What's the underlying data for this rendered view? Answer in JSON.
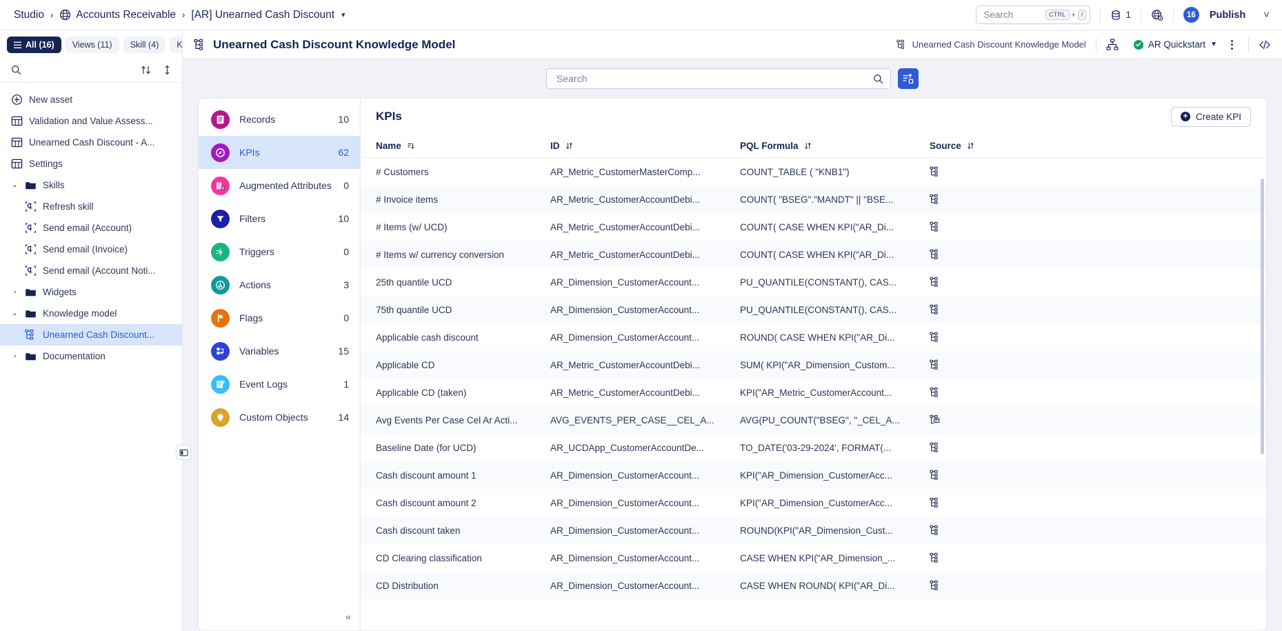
{
  "topbar": {
    "breadcrumbs": [
      {
        "label": "Studio",
        "icon": null
      },
      {
        "label": "Accounts Receivable",
        "icon": "globe-icon"
      },
      {
        "label": "[AR] Unearned Cash Discount",
        "icon": null,
        "caret": true
      }
    ],
    "search": {
      "placeholder": "Search",
      "kbd_ctrl": "CTRL",
      "kbd_plus": "+",
      "kbd_slash": "/"
    },
    "data_pool_count": "1",
    "publish": {
      "badge": "16",
      "label": "Publish"
    }
  },
  "sidebar": {
    "filter_tabs": [
      {
        "label": "All (16)",
        "active": true,
        "icon": "list-icon"
      },
      {
        "label": "Views (11)",
        "active": false
      },
      {
        "label": "Skill (4)",
        "active": false
      },
      {
        "label": "Know",
        "active": false
      },
      {
        "label": "•••",
        "active": false
      }
    ],
    "search_placeholder": "",
    "tree": [
      {
        "label": "New asset",
        "icon": "plus-circle-icon",
        "level": 0,
        "type": "action"
      },
      {
        "label": "Validation and Value Assess...",
        "icon": "view-icon",
        "level": 0,
        "type": "view"
      },
      {
        "label": "Unearned Cash Discount - A...",
        "icon": "view-icon",
        "level": 0,
        "type": "view"
      },
      {
        "label": "Settings",
        "icon": "view-icon",
        "level": 0,
        "type": "view"
      },
      {
        "label": "Skills",
        "icon": "folder-icon",
        "level": 0,
        "type": "folder",
        "expanded": true
      },
      {
        "label": "Refresh skill",
        "icon": "skill-icon",
        "level": 1,
        "type": "skill"
      },
      {
        "label": "Send email (Account)",
        "icon": "skill-icon",
        "level": 1,
        "type": "skill"
      },
      {
        "label": "Send email (Invoice)",
        "icon": "skill-icon",
        "level": 1,
        "type": "skill"
      },
      {
        "label": "Send email (Account Noti...",
        "icon": "skill-icon",
        "level": 1,
        "type": "skill"
      },
      {
        "label": "Widgets",
        "icon": "folder-icon",
        "level": 0,
        "type": "folder",
        "expanded": false
      },
      {
        "label": "Knowledge model",
        "icon": "folder-icon",
        "level": 0,
        "type": "folder",
        "expanded": true
      },
      {
        "label": "Unearned Cash Discount...",
        "icon": "knowledge-model-icon",
        "level": 1,
        "type": "km",
        "selected": true
      },
      {
        "label": "Documentation",
        "icon": "folder-icon",
        "level": 0,
        "type": "folder",
        "expanded": false
      }
    ]
  },
  "main": {
    "title": "Unearned Cash Discount Knowledge Model",
    "header_crumb": "Unearned Cash Discount Knowledge Model",
    "environment": "AR Quickstart",
    "search_placeholder": "Search"
  },
  "categories": [
    {
      "label": "Records",
      "count": "10",
      "color": "#b5168e",
      "icon": "records-icon",
      "active": false
    },
    {
      "label": "KPIs",
      "count": "62",
      "color": "#a21ac0",
      "icon": "kpi-icon",
      "active": true
    },
    {
      "label": "Augmented Attributes",
      "count": "0",
      "color": "#f5359e",
      "icon": "augmented-icon",
      "active": false
    },
    {
      "label": "Filters",
      "count": "10",
      "color": "#1a1ea8",
      "icon": "filter-icon",
      "active": false
    },
    {
      "label": "Triggers",
      "count": "0",
      "color": "#17b583",
      "icon": "trigger-icon",
      "active": false
    },
    {
      "label": "Actions",
      "count": "3",
      "color": "#0d9a9a",
      "icon": "action-icon",
      "active": false
    },
    {
      "label": "Flags",
      "count": "0",
      "color": "#e8730c",
      "icon": "flag-icon",
      "active": false
    },
    {
      "label": "Variables",
      "count": "15",
      "color": "#2f44d4",
      "icon": "variable-icon",
      "active": false
    },
    {
      "label": "Event Logs",
      "count": "1",
      "color": "#38bdf8",
      "icon": "eventlog-icon",
      "active": false
    },
    {
      "label": "Custom Objects",
      "count": "14",
      "color": "#d9a429",
      "icon": "custom-obj-icon",
      "active": false
    }
  ],
  "table": {
    "title": "KPIs",
    "create_label": "Create KPI",
    "columns": [
      {
        "label": "Name",
        "sort": "asc"
      },
      {
        "label": "ID",
        "sort": "none"
      },
      {
        "label": "PQL Formula",
        "sort": "none"
      },
      {
        "label": "Source",
        "sort": "none"
      }
    ],
    "rows": [
      {
        "name": "# Customers",
        "id": "AR_Metric_CustomerMasterComp...",
        "pql": "COUNT_TABLE ( \"KNB1\")",
        "source": "knowledge-model-icon"
      },
      {
        "name": "# Invoice items",
        "id": "AR_Metric_CustomerAccountDebi...",
        "pql": "COUNT( \"BSEG\".\"MANDT\" || \"BSE...",
        "source": "knowledge-model-icon"
      },
      {
        "name": "# Items (w/ UCD)",
        "id": "AR_Metric_CustomerAccountDebi...",
        "pql": "COUNT( CASE WHEN KPI(\"AR_Di...",
        "source": "knowledge-model-icon"
      },
      {
        "name": "# Items w/ currency conversion",
        "id": "AR_Metric_CustomerAccountDebi...",
        "pql": "COUNT( CASE WHEN KPI(\"AR_Di...",
        "source": "knowledge-model-icon"
      },
      {
        "name": "25th quantile UCD",
        "id": "AR_Dimension_CustomerAccount...",
        "pql": "PU_QUANTILE(CONSTANT(), CAS...",
        "source": "knowledge-model-icon"
      },
      {
        "name": "75th quantile UCD",
        "id": "AR_Dimension_CustomerAccount...",
        "pql": "PU_QUANTILE(CONSTANT(), CAS...",
        "source": "knowledge-model-icon"
      },
      {
        "name": "Applicable cash discount",
        "id": "AR_Dimension_CustomerAccount...",
        "pql": "ROUND( CASE WHEN KPI(\"AR_Di...",
        "source": "knowledge-model-icon"
      },
      {
        "name": "Applicable CD",
        "id": "AR_Metric_CustomerAccountDebi...",
        "pql": "SUM( KPI(\"AR_Dimension_Custom...",
        "source": "knowledge-model-icon"
      },
      {
        "name": "Applicable CD (taken)",
        "id": "AR_Metric_CustomerAccountDebi...",
        "pql": "KPI(\"AR_Metric_CustomerAccount...",
        "source": "knowledge-model-icon"
      },
      {
        "name": "Avg Events Per Case Cel Ar Acti...",
        "id": "AVG_EVENTS_PER_CASE__CEL_A...",
        "pql": "AVG(PU_COUNT(\"BSEG\", \"_CEL_A...",
        "source": "event-log-source-icon"
      },
      {
        "name": "Baseline Date (for UCD)",
        "id": "AR_UCDApp_CustomerAccountDe...",
        "pql": "TO_DATE('03-29-2024', FORMAT(...",
        "source": "knowledge-model-icon"
      },
      {
        "name": "Cash discount amount 1",
        "id": "AR_Dimension_CustomerAccount...",
        "pql": "KPI(\"AR_Dimension_CustomerAcc...",
        "source": "knowledge-model-icon"
      },
      {
        "name": "Cash discount amount 2",
        "id": "AR_Dimension_CustomerAccount...",
        "pql": "KPI(\"AR_Dimension_CustomerAcc...",
        "source": "knowledge-model-icon"
      },
      {
        "name": "Cash discount taken",
        "id": "AR_Dimension_CustomerAccount...",
        "pql": "ROUND(KPI(\"AR_Dimension_Cust...",
        "source": "knowledge-model-icon"
      },
      {
        "name": "CD Clearing classification",
        "id": "AR_Dimension_CustomerAccount...",
        "pql": "CASE WHEN KPI(\"AR_Dimension_...",
        "source": "knowledge-model-icon"
      },
      {
        "name": "CD Distribution",
        "id": "AR_Dimension_CustomerAccount...",
        "pql": "CASE WHEN ROUND( KPI(\"AR_Di...",
        "source": "knowledge-model-icon"
      }
    ]
  }
}
